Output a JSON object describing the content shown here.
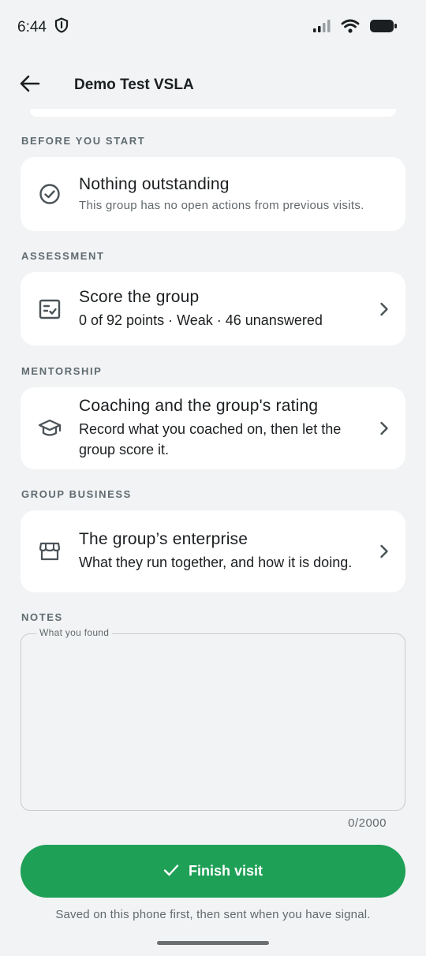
{
  "status_bar": {
    "time": "6:44",
    "icons": [
      "shield-icon",
      "signal-icon",
      "wifi-icon",
      "battery-icon"
    ]
  },
  "app_bar": {
    "title": "Demo Test VSLA",
    "back_icon": "arrow-left-icon"
  },
  "sections": {
    "before_you_start": {
      "label": "BEFORE YOU START",
      "card": {
        "icon": "check-circle-icon",
        "title": "Nothing outstanding",
        "subtitle": "This group has no open actions from previous visits."
      }
    },
    "assessment": {
      "label": "ASSESSMENT",
      "card": {
        "icon": "checklist-icon",
        "title": "Score the group",
        "subtitle": "0 of 92 points · Weak · 46 unanswered"
      }
    },
    "mentorship": {
      "label": "MENTORSHIP",
      "card": {
        "icon": "graduation-cap-icon",
        "title": "Coaching and the group's rating",
        "subtitle": "Record what you coached on, then let the group score it."
      }
    },
    "group_business": {
      "label": "GROUP BUSINESS",
      "card": {
        "icon": "storefront-icon",
        "title": "The group’s enterprise",
        "subtitle": "What they run together, and how it is doing."
      }
    }
  },
  "notes": {
    "label": "NOTES",
    "field_label": "What you found",
    "value": "",
    "counter": "0/2000"
  },
  "finish": {
    "label": "Finish visit",
    "icon": "check-icon",
    "color": "#1fa057"
  },
  "footnote": "Saved on this phone first, then sent when you have signal."
}
